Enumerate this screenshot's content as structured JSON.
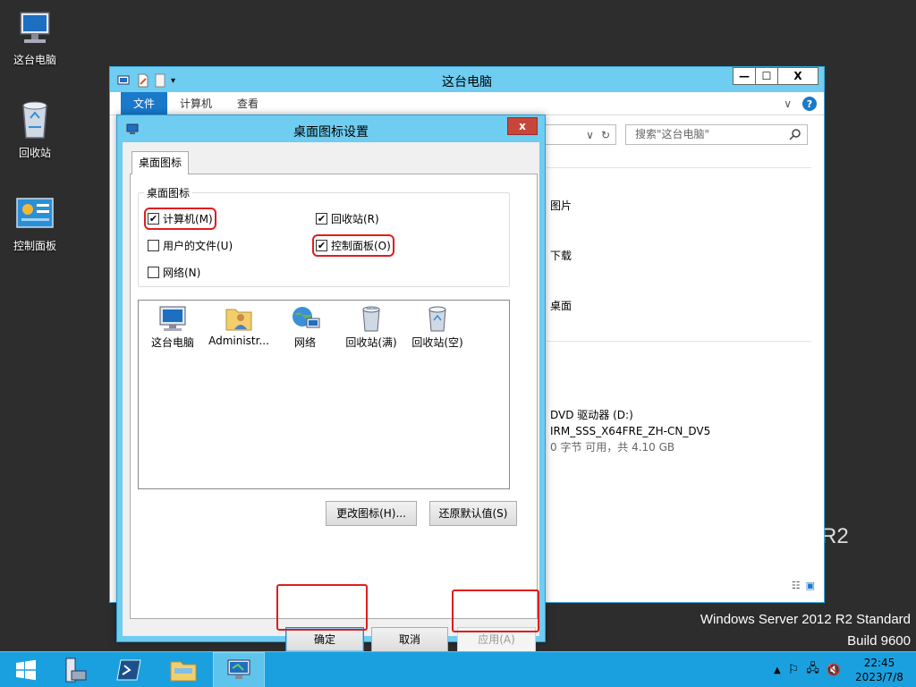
{
  "desktop": {
    "icons": [
      {
        "label": "这台电脑",
        "icon": "computer-icon"
      },
      {
        "label": "回收站",
        "icon": "recycle-bin-icon"
      },
      {
        "label": "控制面板",
        "icon": "control-panel-icon"
      }
    ],
    "watermark_line1": "Windows Server 2012 R2 Standard",
    "watermark_line2": "Build 9600",
    "behind_text": "R2"
  },
  "explorer": {
    "title": "这台电脑",
    "ribbon_tabs": [
      "文件",
      "计算机",
      "查看"
    ],
    "search_placeholder": "搜索\"这台电脑\"",
    "folders": [
      "图片",
      "下载",
      "桌面"
    ],
    "drive": {
      "name": "DVD 驱动器 (D:)",
      "label": "IRM_SSS_X64FRE_ZH-CN_DV5",
      "space": "0 字节 可用，共 4.10 GB"
    }
  },
  "dialog": {
    "title": "桌面图标设置",
    "close_label": "x",
    "tab": "桌面图标",
    "group_title": "桌面图标",
    "checkboxes": [
      {
        "label": "计算机(M)",
        "checked": true
      },
      {
        "label": "回收站(R)",
        "checked": true
      },
      {
        "label": "用户的文件(U)",
        "checked": false
      },
      {
        "label": "控制面板(O)",
        "checked": true
      },
      {
        "label": "网络(N)",
        "checked": false
      }
    ],
    "icons": [
      {
        "label": "这台电脑",
        "icon": "computer-icon"
      },
      {
        "label": "Administr...",
        "icon": "user-folder-icon"
      },
      {
        "label": "网络",
        "icon": "network-icon"
      },
      {
        "label": "回收站(满)",
        "icon": "recycle-bin-full-icon"
      },
      {
        "label": "回收站(空)",
        "icon": "recycle-bin-empty-icon"
      }
    ],
    "change_icon_button": "更改图标(H)...",
    "restore_default_button": "还原默认值(S)",
    "ok_button": "确定",
    "cancel_button": "取消",
    "apply_button": "应用(A)"
  },
  "taskbar": {
    "items": [
      "start-icon",
      "server-manager-icon",
      "powershell-icon",
      "file-explorer-icon",
      "desktop-settings-icon"
    ],
    "time": "22:45",
    "date": "2023/7/8"
  },
  "colors": {
    "accent": "#1aa0de",
    "window_frame": "#6ecdf0",
    "highlight": "#e01d1d"
  }
}
